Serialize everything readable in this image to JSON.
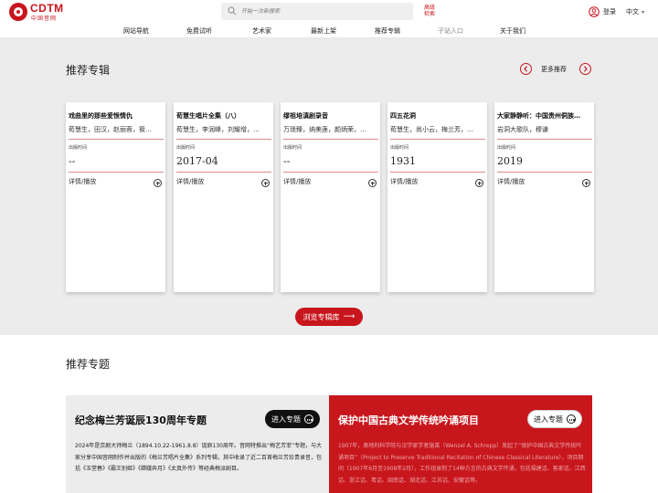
{
  "header": {
    "logo_en": "CDTM",
    "logo_cn": "中国音网",
    "search_placeholder": "开始一次新搜索",
    "advanced_search": "高级检索",
    "login": "登录",
    "language": "中文"
  },
  "nav": {
    "items": [
      "网站导航",
      "免费试听",
      "艺术家",
      "最新上架",
      "推荐专辑",
      "子站入口",
      "关于我们"
    ]
  },
  "albums": {
    "title": "推荐专辑",
    "more": "更多推荐",
    "date_label": "出版时间",
    "action_label": "详情/播放",
    "browse_button": "浏览专辑库",
    "cards": [
      {
        "title": "戏曲里的那些爱恨情仇",
        "artists": "荀慧生，田汉，赵丽蓉，筱…",
        "date": "--"
      },
      {
        "title": "荀慧生唱片全集（八）",
        "artists": "荀慧生，李润峰，刘耀增，…",
        "date": "2017-04"
      },
      {
        "title": "缪祖培滇剧录音",
        "artists": "万琐臻，纳美莲，颜炳荣，…",
        "date": "--"
      },
      {
        "title": "四五花洞",
        "artists": "荀慧生，尚小云，梅兰芳，…",
        "date": "1931"
      },
      {
        "title": "大家静静听：中国贵州侗族…",
        "artists": "岩洞大歌队，穆谦",
        "date": "2019"
      }
    ]
  },
  "topics": {
    "title": "推荐专题",
    "enter_label": "进入专题",
    "items": [
      {
        "heading": "纪念梅兰芳诞辰130周年专题",
        "body": "2024年是京剧大师梅兰（1894.10.22-1961.8.8）诞辰130周年。音网特推出“梅艺芳菲”专题，与大家分享中国音网制作并出版的《梅兰芳唱片全集》系列专辑，其中收录了近二百首梅兰芳珍贵录音，包括《玉堂春》《霸王别姬》《嫦娥奔月》《太真外传》等经典梅派剧目。"
      },
      {
        "heading": "保护中国古典文学传统吟诵项目",
        "body": "1907年，奥地利科学院与汉学家学者施莱（Wenzel A. Schrepp）发起了“保护中国古典文学传统吟诵项目”（Project to Preserve Traditional Recitation of Chinese Classical Literature），项目期间（1907年6月至1908年2月），工作组录制了14种方言的古典文学传诵，包括福建话、客家话、江西话、浙江话、粤话、闽南话、湖北话、江苏话、安徽话等。"
      }
    ]
  },
  "colors": {
    "brand_red": "#c8161d",
    "section_gray": "#ececec"
  }
}
